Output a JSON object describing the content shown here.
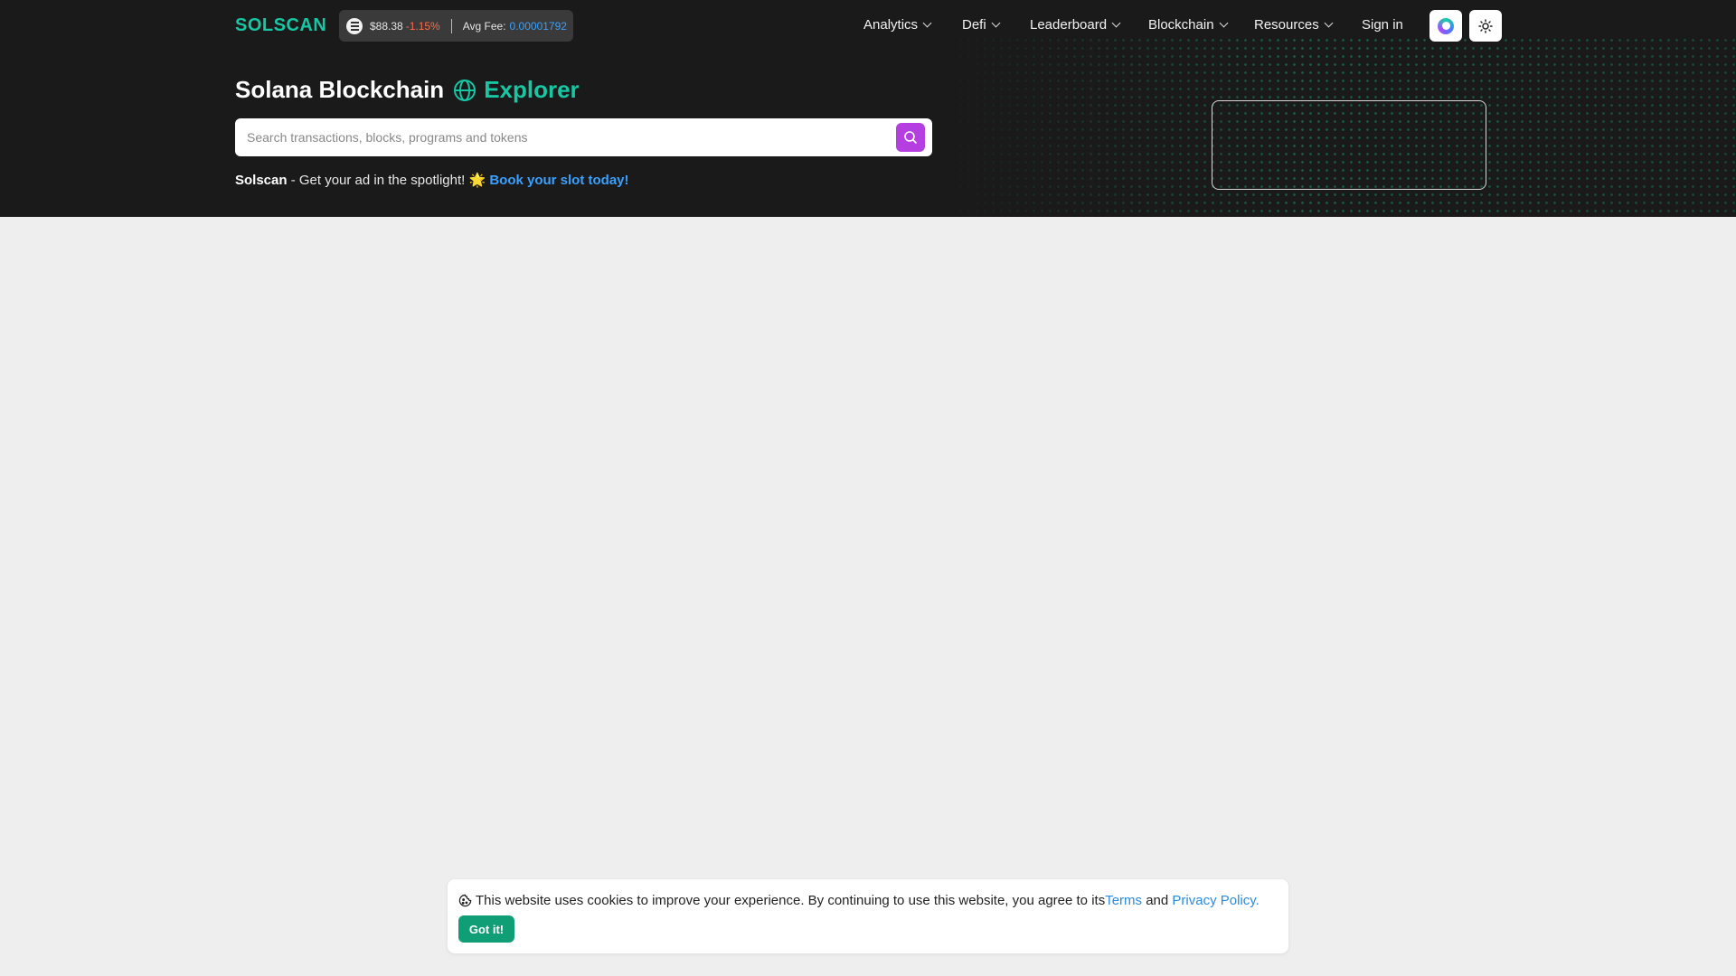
{
  "brand": {
    "logo": "SOLSCAN"
  },
  "stats": {
    "price": "$88.38",
    "change": "-1.15%",
    "fee_label": "Avg Fee:",
    "fee_value": "0.00001792"
  },
  "nav": {
    "items": [
      {
        "label": "Analytics"
      },
      {
        "label": "Defi"
      },
      {
        "label": "Leaderboard"
      },
      {
        "label": "Blockchain"
      },
      {
        "label": "Resources"
      }
    ],
    "signin": "Sign in"
  },
  "hero": {
    "title_main": "Solana Blockchain",
    "title_accent": "Explorer",
    "search_placeholder": "Search transactions, blocks, programs and tokens",
    "promo_brand": "Solscan",
    "promo_text": " - Get your ad in the spotlight! 🌟 ",
    "promo_link": "Book your slot today!"
  },
  "cookie": {
    "text": "This website uses cookies to improve your experience. By continuing to use this website, you agree to its ",
    "terms": "Terms",
    "and": " and ",
    "privacy": "Privacy Policy.",
    "button": "Got it!"
  },
  "colors": {
    "accent": "#17c7a3",
    "search_button": "#b43ee0",
    "link": "#3aa0ff",
    "negative": "#ff6b4a",
    "cookie_button": "#0f9e76"
  },
  "icons": [
    "solana-icon",
    "chevron-down-icon",
    "app-ring-icon",
    "sun-icon",
    "globe-icon",
    "search-icon",
    "cookie-icon"
  ]
}
